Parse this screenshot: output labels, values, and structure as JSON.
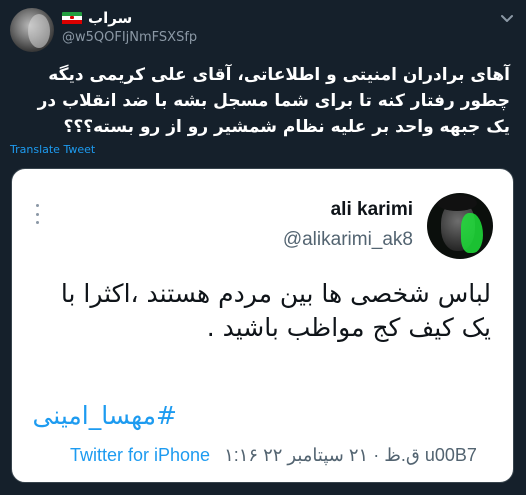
{
  "outer_tweet": {
    "display_name": "سراب",
    "handle": "@w5QOFIjNmFSXSfp",
    "text": "آهای برادران امنیتی و اطلاعاتی، آقای علی کریمی دیگه چطور رفتار کنه تا برای شما مسجل بشه با ضد انقلاب در یک جبهه واحد بر علیه نظام شمشیر رو از رو بسته؟؟؟",
    "translate_label": "Translate Tweet",
    "icons": {
      "flag": "iran-flag-icon",
      "menu": "chevron-down-icon"
    }
  },
  "quoted_tweet": {
    "display_name": "ali karimi",
    "handle": "@alikarimi_ak8",
    "text": "لباس شخصی ها بین مردم هستند ،اکثرا با یک کیف کج مواظب باشید .",
    "hashtag": "#مهسا_امینی",
    "timestamp": "۱:۱۶ ق.ظ · ۲۱ سپتامبر ۲۲ u00B7",
    "source": "Twitter for iPhone",
    "icons": {
      "menu": "more-dots-icon"
    },
    "colors": {
      "link": "#1d9bf0",
      "avatar_paint": "#1fe03a"
    }
  },
  "theme": {
    "background": "#15202b",
    "card_background": "#ffffff"
  }
}
